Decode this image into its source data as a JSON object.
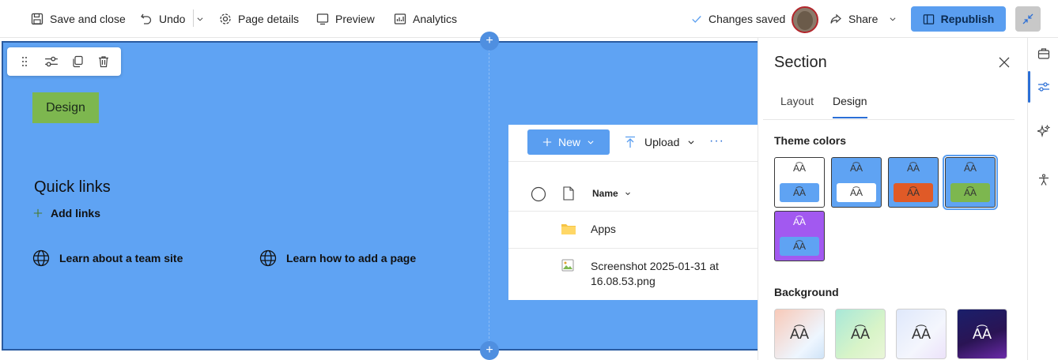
{
  "topbar": {
    "save_close": "Save and close",
    "undo": "Undo",
    "page_details": "Page details",
    "preview": "Preview",
    "analytics": "Analytics",
    "changes_saved": "Changes saved",
    "share": "Share",
    "republish": "Republish"
  },
  "canvas": {
    "design_chip": "Design",
    "quick_links_title": "Quick links",
    "add_links": "Add links",
    "links": [
      "Learn about a team site",
      "Learn how to add a page"
    ]
  },
  "doclib": {
    "new_label": "New",
    "upload_label": "Upload",
    "more": "···",
    "name_header": "Name",
    "rows": [
      "Apps",
      "Screenshot 2025-01-31 at 16.08.53.png"
    ]
  },
  "panel": {
    "title": "Section",
    "tabs": [
      "Layout",
      "Design"
    ],
    "active_tab": "Design",
    "theme_colors_label": "Theme colors",
    "background_label": "Background",
    "swatch_glyph": "A͡A",
    "swatches": [
      {
        "name": "white",
        "top": "#ffffff",
        "bottom": "#5fa3f3"
      },
      {
        "name": "blue-white",
        "top": "#5fa3f3",
        "bottom": "#ffffff"
      },
      {
        "name": "blue-orange",
        "top": "#5fa3f3",
        "bottom": "#e05a27"
      },
      {
        "name": "blue-green",
        "top": "#5fa3f3",
        "bottom": "#7db74f",
        "selected": true
      },
      {
        "name": "purple-blue",
        "top": "#a259f0",
        "bottom": "#5fa3f3"
      }
    ]
  },
  "colors": {
    "canvas_blue": "#5fa3f3",
    "accent": "#2b6fd6",
    "design_green": "#7db74f"
  }
}
